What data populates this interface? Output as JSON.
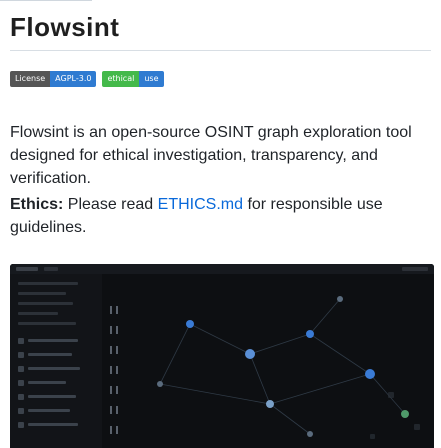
{
  "readme": {
    "title": "Flowsint",
    "badges": [
      {
        "label": "License",
        "value": "AGPL-3.0",
        "color": "#2f7bd1"
      },
      {
        "label": "ethical",
        "value": "use",
        "color": "#44b94a"
      }
    ],
    "intro": "Flowsint is an open-source OSINT graph exploration tool designed for ethical investigation, transparency, and verification.",
    "ethics": {
      "heading": "Ethics:",
      "before_link": "Please read",
      "link_text": "ETHICS.md",
      "after_link": "for responsible use guidelines."
    }
  },
  "colors": {
    "link": "#0969da",
    "screenshot_bg": "#0d0f12",
    "graph_accent": "#2f7bd1"
  }
}
